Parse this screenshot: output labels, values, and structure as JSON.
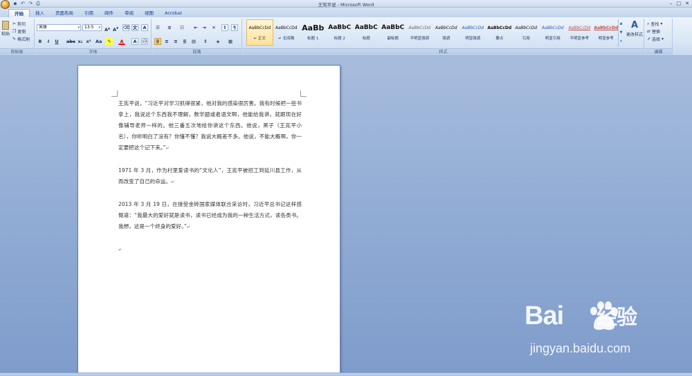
{
  "window": {
    "title": "王宪平说 - Microsoft Word",
    "controls": [
      "–",
      "□",
      "✕"
    ]
  },
  "qat": [
    "save-icon",
    "undo-icon",
    "redo-icon",
    "print-icon"
  ],
  "tabs": [
    "开始",
    "插入",
    "页面布局",
    "引用",
    "邮件",
    "审阅",
    "视图",
    "Acrobat"
  ],
  "clipboard": {
    "paste": "粘贴",
    "cut": "剪切",
    "copy": "复制",
    "format_painter": "格式刷",
    "label": "剪贴板"
  },
  "font": {
    "name": "宋体",
    "size": "13.5",
    "label": "字体"
  },
  "paragraph": {
    "label": "段落"
  },
  "styles": {
    "label": "样式",
    "items": [
      {
        "preview": "AaBbCcDd",
        "name": "↵ 正文"
      },
      {
        "preview": "AaBbCcDd",
        "name": "↵ 无间隔"
      },
      {
        "preview": "AaBb",
        "name": "标题 1"
      },
      {
        "preview": "AaBbC",
        "name": "标题 2"
      },
      {
        "preview": "AaBbC",
        "name": "标题"
      },
      {
        "preview": "AaBbC",
        "name": "副标题"
      },
      {
        "preview": "AaBbCcDd",
        "name": "不明显强调"
      },
      {
        "preview": "AaBbCcDd",
        "name": "强调"
      },
      {
        "preview": "AaBbCcDd",
        "name": "明显强调"
      },
      {
        "preview": "AaBbCcDd",
        "name": "要点"
      },
      {
        "preview": "AaBbCcDd",
        "name": "引用"
      },
      {
        "preview": "AaBbCcDd",
        "name": "明显引用"
      },
      {
        "preview": "AaBbCcDd",
        "name": "不明显参考"
      },
      {
        "preview": "AaBbCcDd",
        "name": "明显参考"
      }
    ],
    "change_styles": "更改样式"
  },
  "editing": {
    "find": "查找",
    "replace": "替换",
    "select": "选择",
    "label": "编辑"
  },
  "document": {
    "paragraphs": [
      "王宪平说，“习近平对学习抓得很紧，他对我的感染很厉害。我有时候把一些书拿上，我说这个东西我不理解，数学题或者语文啊，他能给我讲，就跟现在好像辅导老师一样的。他三番五次地给你讲这个东西。他说，黑子（王宪平小名），你听明白了没有？你懂不懂？我说大概差不多。他说，不能大概啊，你一定要把这个记下来。”",
      "1971 年 3 月，作为村里爱读书的“文化人”，王宪平被招工到延川县工作，从而改变了自己的命运。",
      "2013 年 3 月 19 日，在接受金砖国家媒体联合采访时，习近平总书记这样感慨道：“我最大的爱好就是读书，读书已经成为我的一种生活方式，读各类书。我想，这是一个终身的爱好。”"
    ],
    "para_mark": "↵"
  },
  "watermark": {
    "logo_left": "Bai",
    "logo_right": "经验",
    "url": "jingyan.baidu.com"
  },
  "colors": {
    "accent": "#15428b",
    "background": "#9cb3d8",
    "watermark": "#ffffff"
  }
}
